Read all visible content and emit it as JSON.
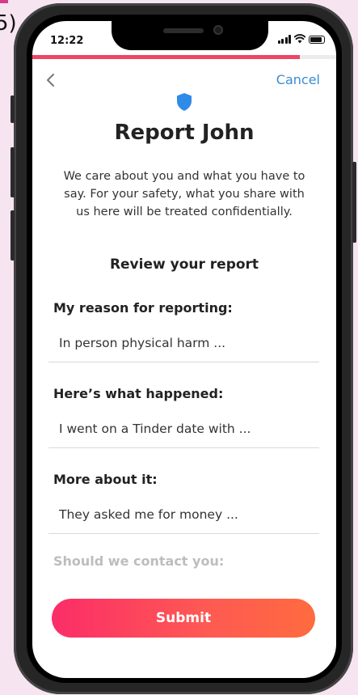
{
  "figure_label": "5)",
  "status_bar": {
    "time": "12:22"
  },
  "progress": {
    "fraction": 0.88,
    "color": "#ee4664"
  },
  "nav": {
    "back_icon": "chevron-left-icon",
    "cancel_label": "Cancel",
    "cancel_color": "#3a8cd0"
  },
  "header": {
    "icon": "shield-icon",
    "icon_color": "#2e8be8",
    "title": "Report John"
  },
  "intro": "We care about you and what you have to say. For your safety, what you share with us here will be treated confidentially.",
  "review_heading": "Review your report",
  "sections": [
    {
      "label": "My reason for reporting:",
      "value": "In person physical harm ..."
    },
    {
      "label": "Here’s what happened:",
      "value": "I went on a Tinder date with ..."
    },
    {
      "label": "More about it:",
      "value": "They asked me for money ..."
    }
  ],
  "contact_label": "Should we contact you:",
  "submit": {
    "label": "Submit",
    "gradient": [
      "#fb2d68",
      "#ff6b3f"
    ]
  }
}
